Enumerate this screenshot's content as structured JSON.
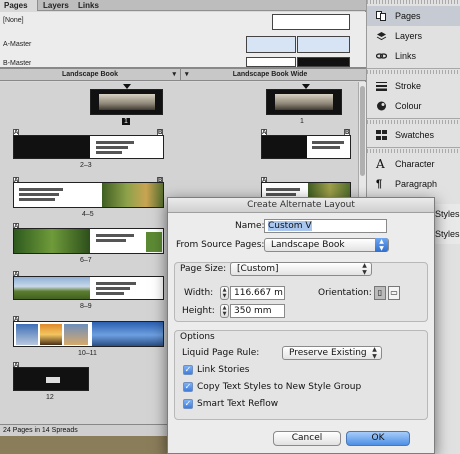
{
  "pages_panel": {
    "tabs": [
      "Pages",
      "Layers",
      "Links"
    ],
    "masters": [
      "[None]",
      "A-Master",
      "B-Master"
    ],
    "layout_columns": [
      "Landscape Book",
      "Landscape Book Wide"
    ],
    "spread_labels": [
      "1",
      "2–3",
      "4–5",
      "6–7",
      "8–9",
      "10–11",
      "12"
    ],
    "wide_label": "1",
    "badges": [
      "A",
      "B"
    ],
    "status": "24 Pages in 14 Spreads"
  },
  "sidebar": {
    "items": [
      "Pages",
      "Layers",
      "Links",
      "Stroke",
      "Colour",
      "Swatches",
      "Character",
      "Paragraph"
    ],
    "partial": [
      "Styles",
      "Styles"
    ],
    "glyph": "A"
  },
  "dialog": {
    "title": "Create Alternate Layout",
    "name_label": "Name:",
    "name_value": "Custom V",
    "source_label": "From Source Pages:",
    "source_value": "Landscape Book",
    "page_size_label": "Page Size:",
    "page_size_value": "[Custom]",
    "width_label": "Width:",
    "width_value": "116.667 m",
    "height_label": "Height:",
    "height_value": "350 mm",
    "orientation_label": "Orientation:",
    "options_label": "Options",
    "liquid_label": "Liquid Page Rule:",
    "liquid_value": "Preserve Existing",
    "checkboxes": [
      "Link Stories",
      "Copy Text Styles to New Style Group",
      "Smart Text Reflow"
    ],
    "cancel_label": "Cancel",
    "ok_label": "OK",
    "accent": "#3f7ddb"
  }
}
